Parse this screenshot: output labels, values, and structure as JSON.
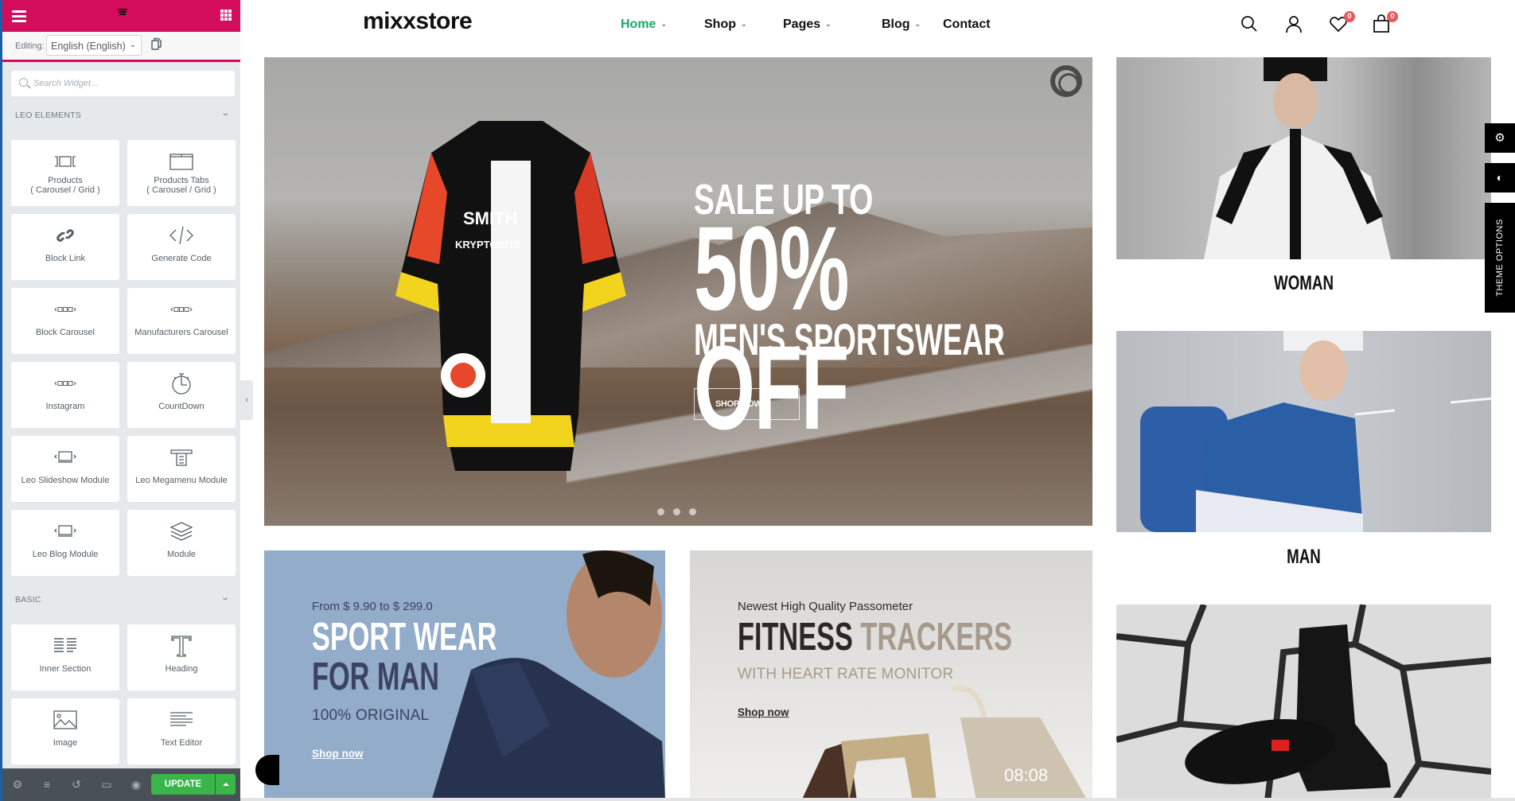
{
  "sidebar": {
    "editing_label": "Editing:",
    "language": "English (English)",
    "search_placeholder": "Search Widget...",
    "sections": [
      {
        "title": "LEO ELEMENTS",
        "widgets": [
          {
            "label": "Products",
            "label2": "( Carousel / Grid )",
            "icon": "products-carousel-icon"
          },
          {
            "label": "Products Tabs",
            "label2": "( Carousel / Grid )",
            "icon": "tabs-folder-icon"
          },
          {
            "label": "Block Link",
            "icon": "link-icon"
          },
          {
            "label": "Generate Code",
            "icon": "code-icon"
          },
          {
            "label": "Block Carousel",
            "icon": "carousel-icon"
          },
          {
            "label": "Manufacturers Carousel",
            "icon": "carousel-icon"
          },
          {
            "label": "Instagram",
            "icon": "carousel-icon"
          },
          {
            "label": "CountDown",
            "icon": "stopwatch-icon"
          },
          {
            "label": "Leo Slideshow Module",
            "icon": "slideshow-icon"
          },
          {
            "label": "Leo Megamenu Module",
            "icon": "megamenu-icon"
          },
          {
            "label": "Leo Blog Module",
            "icon": "slideshow-icon"
          },
          {
            "label": "Module",
            "icon": "layers-icon"
          }
        ]
      },
      {
        "title": "BASIC",
        "widgets": [
          {
            "label": "Inner Section",
            "icon": "columns-icon"
          },
          {
            "label": "Heading",
            "icon": "heading-t-icon"
          },
          {
            "label": "Image",
            "icon": "image-icon"
          },
          {
            "label": "Text Editor",
            "icon": "text-align-icon"
          }
        ]
      }
    ],
    "footer": {
      "update_label": "UPDATE"
    }
  },
  "header": {
    "logo": "mixxstore",
    "nav": [
      {
        "label": "Home",
        "dropdown": true,
        "active": true
      },
      {
        "label": "Shop",
        "dropdown": true
      },
      {
        "label": "Pages",
        "dropdown": true
      },
      {
        "label": "Blog",
        "dropdown": true
      },
      {
        "label": "Contact",
        "dropdown": false
      }
    ],
    "wishlist_count": "0",
    "cart_count": "0",
    "accent_color": "#1aa56b"
  },
  "hero": {
    "line1": "SALE UP TO",
    "line2": "50% OFF",
    "line3": "MEN'S SPORTSWEAR",
    "cta": "SHOP NOW",
    "slides": 3,
    "jersey_text": [
      "SMITH",
      "KRYPTONITE"
    ]
  },
  "categories": [
    {
      "title": "WOMAN"
    },
    {
      "title": "MAN"
    }
  ],
  "banners": [
    {
      "subtitle": "From $ 9.90 to $ 299.0",
      "title1": "SPORT WEAR",
      "title2": "FOR MAN",
      "tagline": "100% ORIGINAL",
      "link": "Shop now"
    },
    {
      "subtitle": "Newest High Quality Passometer",
      "title1": "FITNESS",
      "title2": "TRACKERS",
      "tagline": "WITH HEART RATE MONITOR",
      "link": "Shop now",
      "watch_time": "08:08"
    }
  ],
  "theme_options": {
    "label": "THEME OPTIONS"
  }
}
